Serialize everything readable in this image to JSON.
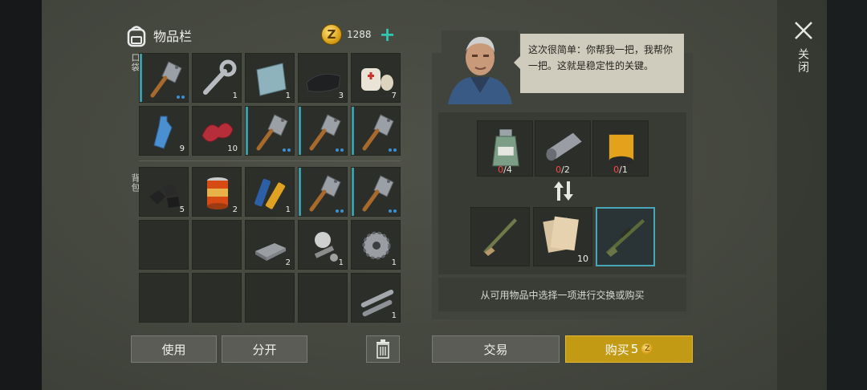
{
  "inventory": {
    "title": "物品栏",
    "coins": "1288",
    "add_coins_symbol": "+",
    "pocket_label": "口袋",
    "backpack_label": "背包",
    "pocket_items": [
      {
        "icon": "cleaver-icon",
        "qty": "",
        "dots": true,
        "marked": true
      },
      {
        "icon": "wrench-icon",
        "qty": "1",
        "dots": false,
        "marked": false
      },
      {
        "icon": "metal-plate-icon",
        "qty": "1",
        "dots": false,
        "marked": false
      },
      {
        "icon": "cloth-icon",
        "qty": "3",
        "dots": false,
        "marked": false
      },
      {
        "icon": "bandage-icon",
        "qty": "7",
        "dots": false,
        "marked": false
      },
      {
        "icon": "water-bottle-icon",
        "qty": "9",
        "dots": false,
        "marked": false
      },
      {
        "icon": "raw-meat-icon",
        "qty": "10",
        "dots": false,
        "marked": false
      },
      {
        "icon": "cleaver-icon",
        "qty": "",
        "dots": true,
        "marked": true
      },
      {
        "icon": "cleaver-icon",
        "qty": "",
        "dots": true,
        "marked": true
      },
      {
        "icon": "cleaver-icon",
        "qty": "",
        "dots": true,
        "marked": true
      }
    ],
    "backpack_items": [
      {
        "icon": "coal-icon",
        "qty": "5",
        "dots": false,
        "marked": false
      },
      {
        "icon": "canned-food-icon",
        "qty": "2",
        "dots": false,
        "marked": false
      },
      {
        "icon": "batteries-icon",
        "qty": "1",
        "dots": false,
        "marked": false
      },
      {
        "icon": "cleaver-icon",
        "qty": "",
        "dots": true,
        "marked": true
      },
      {
        "icon": "cleaver-icon",
        "qty": "",
        "dots": true,
        "marked": true
      },
      {
        "icon": "empty",
        "qty": "",
        "dots": false,
        "marked": false
      },
      {
        "icon": "empty",
        "qty": "",
        "dots": false,
        "marked": false
      },
      {
        "icon": "iron-bar-icon",
        "qty": "2",
        "dots": false,
        "marked": false
      },
      {
        "icon": "gas-mask-parts-icon",
        "qty": "1",
        "dots": false,
        "marked": false
      },
      {
        "icon": "saw-blade-icon",
        "qty": "1",
        "dots": false,
        "marked": false
      },
      {
        "icon": "empty",
        "qty": "",
        "dots": false,
        "marked": false
      },
      {
        "icon": "empty",
        "qty": "",
        "dots": false,
        "marked": false
      },
      {
        "icon": "empty",
        "qty": "",
        "dots": false,
        "marked": false
      },
      {
        "icon": "empty",
        "qty": "",
        "dots": false,
        "marked": false
      },
      {
        "icon": "pipes-icon",
        "qty": "1",
        "dots": false,
        "marked": false
      }
    ],
    "use_button": "使用",
    "split_button": "分开"
  },
  "trader": {
    "speech": "这次很简单：你帮我一把，我帮你一把。这就是稳定性的关键。",
    "required": [
      {
        "icon": "chemical-jar-icon",
        "have": "0",
        "need": "/4"
      },
      {
        "icon": "fabric-roll-icon",
        "have": "0",
        "need": "/2"
      },
      {
        "icon": "filter-icon",
        "have": "0",
        "need": "/1"
      }
    ],
    "offers": [
      {
        "icon": "shotgun-icon",
        "qty": "",
        "selected": false
      },
      {
        "icon": "maps-icon",
        "qty": "10",
        "selected": false
      },
      {
        "icon": "sniper-rifle-icon",
        "qty": "",
        "selected": true
      }
    ],
    "hint": "从可用物品中选择一项进行交换或购买",
    "trade_button": "交易",
    "buy_button": "购买",
    "buy_price": "5"
  },
  "close_label": "关闭",
  "coin_glyph": "Z",
  "colors": {
    "accent": "#2fc7b0",
    "gold": "#c39a14",
    "marker": "#3e9aa6",
    "missing": "#ff4747"
  }
}
